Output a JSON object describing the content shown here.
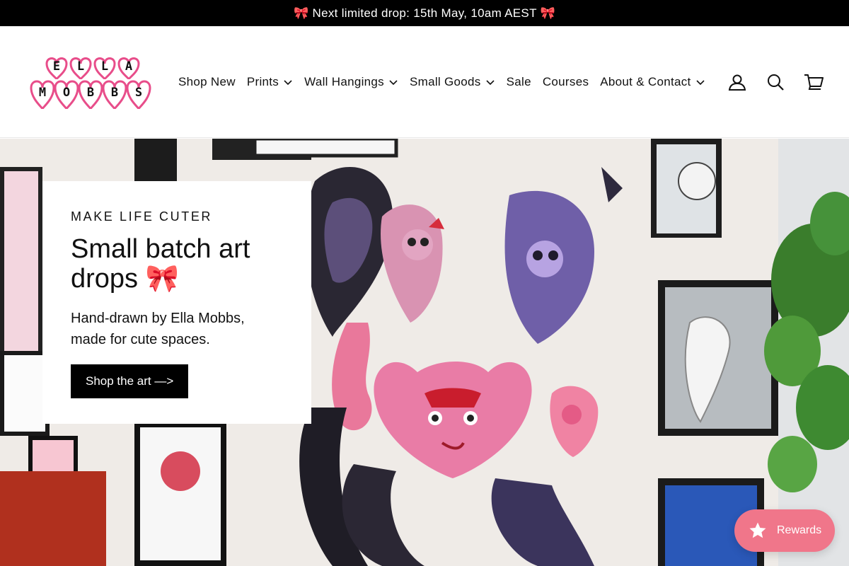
{
  "announcement": {
    "text": "🎀 Next limited drop: 15th May, 10am AEST 🎀"
  },
  "logo": {
    "line1": "ELLA",
    "line2": "MOBBS",
    "alt": "Ella Mobbs logo"
  },
  "nav": [
    {
      "label": "Shop New",
      "dropdown": false
    },
    {
      "label": "Prints",
      "dropdown": true
    },
    {
      "label": "Wall Hangings",
      "dropdown": true
    },
    {
      "label": "Small Goods",
      "dropdown": true
    },
    {
      "label": "Sale",
      "dropdown": false
    },
    {
      "label": "Courses",
      "dropdown": false
    },
    {
      "label": "About & Contact",
      "dropdown": true
    }
  ],
  "icons": {
    "account": "user-icon",
    "search": "search-icon",
    "cart": "cart-icon"
  },
  "hero": {
    "eyebrow": "MAKE LIFE CUTER",
    "headline": "Small batch art drops 🎀",
    "subtext": "Hand-drawn by Ella Mobbs, made for cute spaces.",
    "cta": "Shop the art —>"
  },
  "rewards": {
    "label": "Rewards",
    "icon": "star-icon"
  },
  "colors": {
    "accent": "#f0768a",
    "logo_pink": "#e84d8a",
    "black": "#000000"
  }
}
